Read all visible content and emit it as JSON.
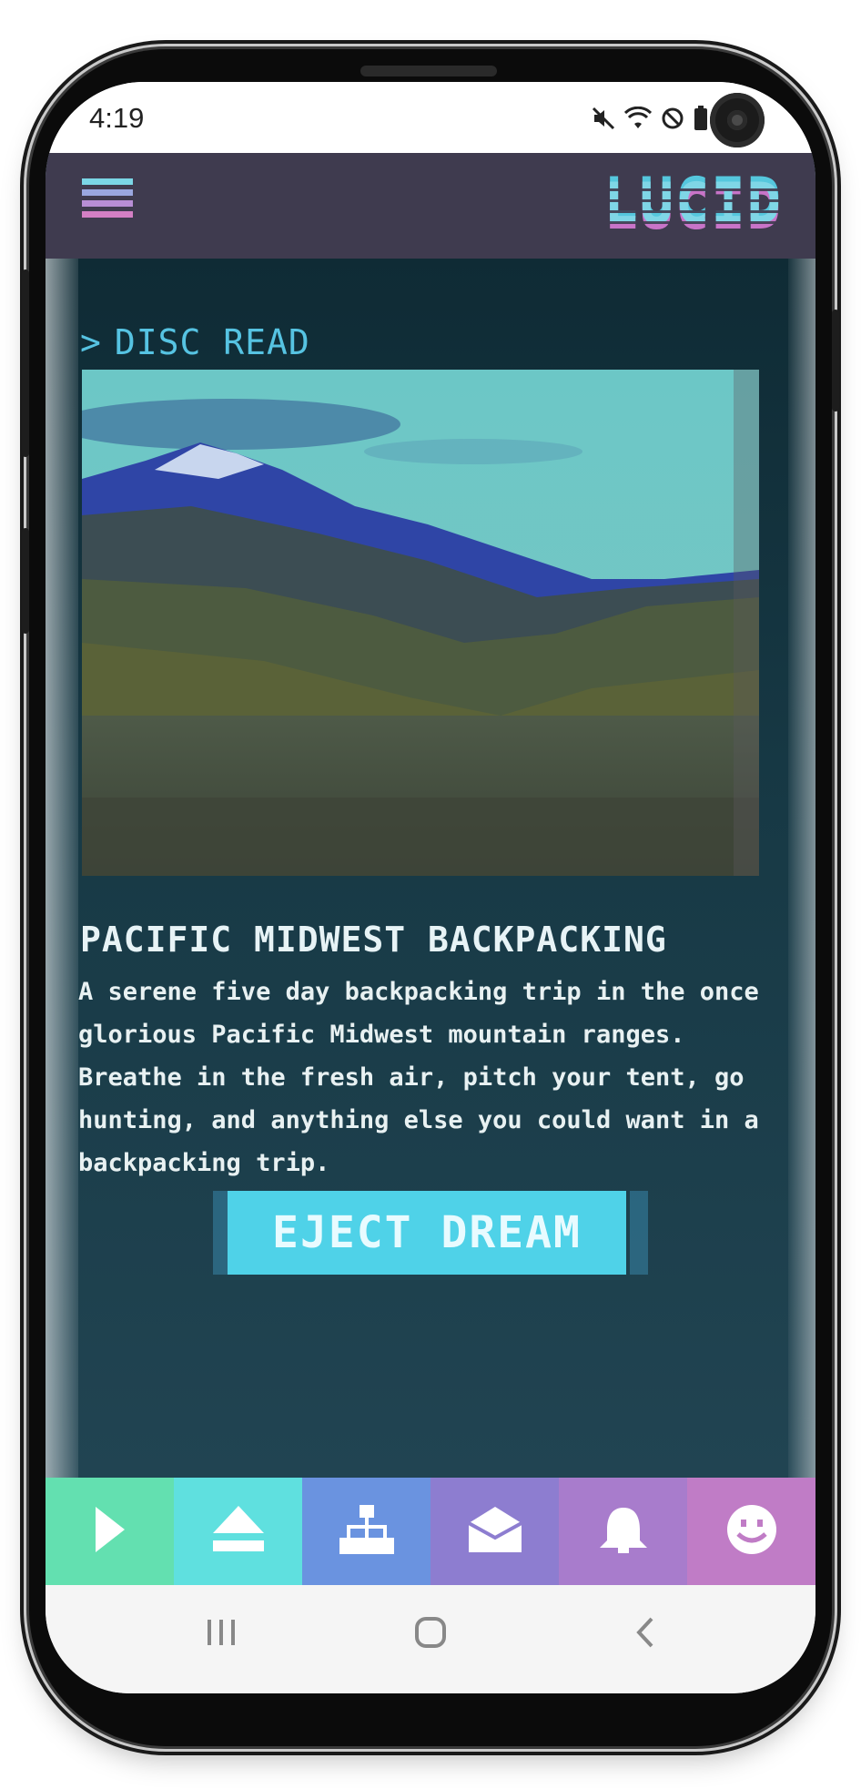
{
  "status_bar": {
    "time": "4:19",
    "icons": [
      "mute-icon",
      "wifi-icon",
      "do-not-disturb-icon",
      "battery-icon"
    ]
  },
  "app": {
    "logo": "LUCID",
    "menu_icon": "hamburger-menu-icon",
    "colors": {
      "topbar": "#3f3b4f",
      "accent_cyan": "#4fd2e8",
      "breadcrumb": "#56c3e2",
      "logo_cyan": "#7fd6e6",
      "logo_pink": "#c874c8"
    }
  },
  "breadcrumb": {
    "chevron": ">",
    "label": "DISC READ"
  },
  "dream": {
    "image_alt": "mountain-valley-photo",
    "title": "PACIFIC MIDWEST BACKPACKING",
    "description": "A serene five day backpacking trip in the once glorious Pacific Midwest mountain ranges. Breathe in the fresh air, pitch your tent, go hunting, and anything else you could want in a backpacking trip."
  },
  "eject_button": {
    "label": "EJECT DREAM"
  },
  "tabs": [
    {
      "icon": "play-icon",
      "color": "#63e0b0"
    },
    {
      "icon": "eject-icon",
      "color": "#5fe0df"
    },
    {
      "icon": "network-icon",
      "color": "#6a93e0"
    },
    {
      "icon": "mail-icon",
      "color": "#8d7dd0"
    },
    {
      "icon": "bell-icon",
      "color": "#a87ccc"
    },
    {
      "icon": "smiley-icon",
      "color": "#c07cc6"
    }
  ],
  "nav_bar": {
    "buttons": [
      "recent-apps-icon",
      "home-icon",
      "back-icon"
    ]
  }
}
